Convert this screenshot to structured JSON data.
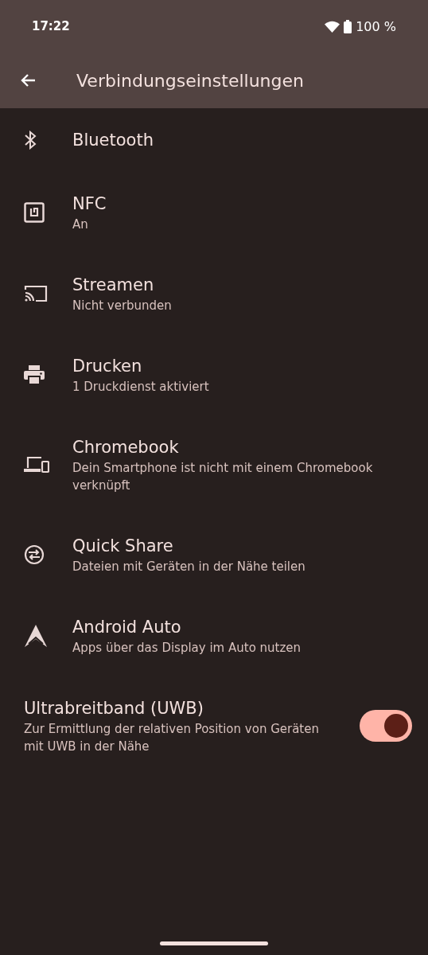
{
  "status_bar": {
    "time": "17:22",
    "battery": "100 %"
  },
  "app_bar": {
    "title": "Verbindungseinstellungen"
  },
  "items": [
    {
      "kind": "link",
      "title": "Bluetooth"
    },
    {
      "kind": "link",
      "title": "NFC",
      "summary": "An"
    },
    {
      "kind": "link",
      "title": "Streamen",
      "summary": "Nicht verbunden"
    },
    {
      "kind": "link",
      "title": "Drucken",
      "summary": "1 Druckdienst aktiviert"
    },
    {
      "kind": "link",
      "title": "Chromebook",
      "summary": "Dein Smartphone ist nicht mit einem Chromebook verknüpft"
    },
    {
      "kind": "link",
      "title": "Quick Share",
      "summary": "Dateien mit Geräten in der Nähe teilen"
    },
    {
      "kind": "link",
      "title": "Android Auto",
      "summary": "Apps über das Display im Auto nutzen"
    },
    {
      "kind": "toggle",
      "title": "Ultrabreitband (UWB)",
      "summary": "Zur Ermittlung der relativen Position von Geräten mit UWB in der Nähe",
      "on": true
    }
  ]
}
